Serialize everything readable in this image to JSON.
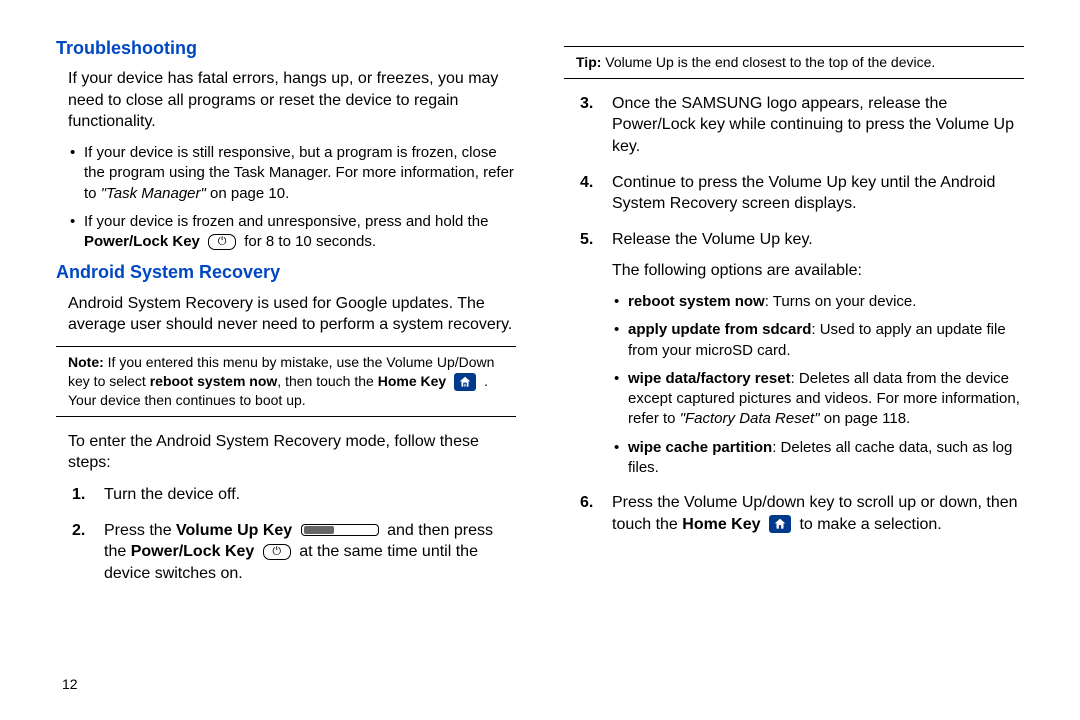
{
  "page_number": "12",
  "left": {
    "h_troubleshoot": "Troubleshooting",
    "intro": "If your device has fatal errors, hangs up, or freezes, you may need to close all programs or reset the device to regain functionality.",
    "b1_a": "If your device is still responsive, but a program is frozen, close the program using the Task Manager. For more information, refer to ",
    "b1_ref": "\"Task Manager\"",
    "b1_b": " on page 10.",
    "b2_a": "If your device is frozen and unresponsive, press and hold the ",
    "b2_key": "Power/Lock Key",
    "b2_b": " for 8 to 10 seconds.",
    "h_recovery": "Android System Recovery",
    "recovery_intro": "Android System Recovery is used for Google updates. The average user should never need to perform a system recovery.",
    "note_label": "Note:",
    "note_a": " If you entered this menu by mistake, use the Volume Up/Down key to select ",
    "note_bold1": "reboot system now",
    "note_b": ", then touch the ",
    "note_bold2": "Home Key",
    "note_c": " . Your device then continues to boot up.",
    "enter_mode": "To enter the Android System Recovery mode, follow these steps:",
    "s1_num": "1.",
    "s1": "Turn the device off.",
    "s2_num": "2.",
    "s2_a": "Press the ",
    "s2_bold1": "Volume Up Key",
    "s2_b": " and then press the ",
    "s2_bold2": "Power/Lock Key",
    "s2_c": " at the same time until the device switches on."
  },
  "right": {
    "tip_label": "Tip:",
    "tip_text": " Volume Up is the end closest to the top of the device.",
    "s3_num": "3.",
    "s3": "Once the SAMSUNG logo appears, release the Power/Lock key while continuing to press the Volume Up key.",
    "s4_num": "4.",
    "s4": "Continue to press the Volume Up key until the Android System Recovery screen displays.",
    "s5_num": "5.",
    "s5": "Release the Volume Up key.",
    "following": "The following options are available:",
    "opt1_b": "reboot system now",
    "opt1_t": ": Turns on your device.",
    "opt2_b": "apply update from sdcard",
    "opt2_t": ": Used to apply an update file from your microSD card.",
    "opt3_b": "wipe data/factory reset",
    "opt3_t": ": Deletes all data from the device except captured pictures and videos. For more information, refer to ",
    "opt3_ref": "\"Factory Data Reset\"",
    "opt3_pg": " on page 118.",
    "opt4_b": "wipe cache partition",
    "opt4_t": ": Deletes all cache data, such as log files.",
    "s6_num": "6.",
    "s6_a": "Press the Volume Up/down key to scroll up or down, then touch the ",
    "s6_bold": "Home Key",
    "s6_b": " to make a selection."
  }
}
